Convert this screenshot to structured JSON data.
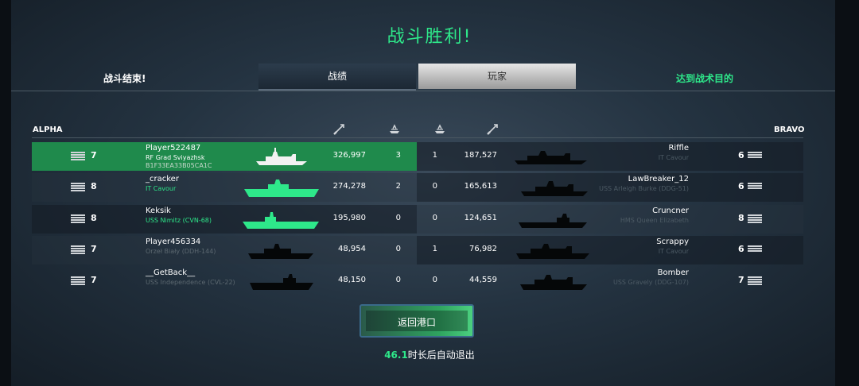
{
  "title": "战斗胜利!",
  "tabs": {
    "left_label": "战斗结束!",
    "stats_label": "战绩",
    "players_label": "玩家",
    "right_label": "达到战术目的"
  },
  "teams": {
    "left": "ALPHA",
    "right": "BRAVO"
  },
  "columns_icons": [
    "damage-icon",
    "kills-icon",
    "kills-icon",
    "damage-icon"
  ],
  "rows": [
    {
      "level": "7",
      "name": "Player522487",
      "ship": "RF Grad Sviyazhsk",
      "id": "B1F33EA33B05CA1C",
      "damage": "326,997",
      "kills": "3",
      "enemy_kills": "1",
      "enemy_damage": "187,527",
      "enemy_name": "Riffle",
      "enemy_ship": "IT Cavour",
      "enemy_level": "6"
    },
    {
      "level": "8",
      "name": "_cracker",
      "ship": "IT Cavour",
      "id": "",
      "damage": "274,278",
      "kills": "2",
      "enemy_kills": "0",
      "enemy_damage": "165,613",
      "enemy_name": "LawBreaker_12",
      "enemy_ship": "USS Arleigh Burke (DDG-51)",
      "enemy_level": "6"
    },
    {
      "level": "8",
      "name": "Keksik",
      "ship": "USS Nimitz (CVN-68)",
      "id": "",
      "damage": "195,980",
      "kills": "0",
      "enemy_kills": "0",
      "enemy_damage": "124,651",
      "enemy_name": "Cruncner",
      "enemy_ship": "HMS Queen Elizabeth",
      "enemy_level": "8"
    },
    {
      "level": "7",
      "name": "Player456334",
      "ship": "Orzeł Biały (DDH-144)",
      "id": "",
      "damage": "48,954",
      "kills": "0",
      "enemy_kills": "1",
      "enemy_damage": "76,982",
      "enemy_name": "Scrappy",
      "enemy_ship": "IT Cavour",
      "enemy_level": "6"
    },
    {
      "level": "7",
      "name": "__GetBack__",
      "ship": "USS Independence (CVL-22)",
      "id": "",
      "damage": "48,150",
      "kills": "0",
      "enemy_kills": "0",
      "enemy_damage": "44,559",
      "enemy_name": "Bomber",
      "enemy_ship": "USS Gravely (DDG-107)",
      "enemy_level": "7"
    }
  ],
  "back_button": "返回港口",
  "countdown": {
    "seconds": "46.1",
    "text": "时长后自动退出"
  },
  "colors": {
    "accent": "#2ee88a",
    "highlight_row": "#1f8a4c"
  }
}
